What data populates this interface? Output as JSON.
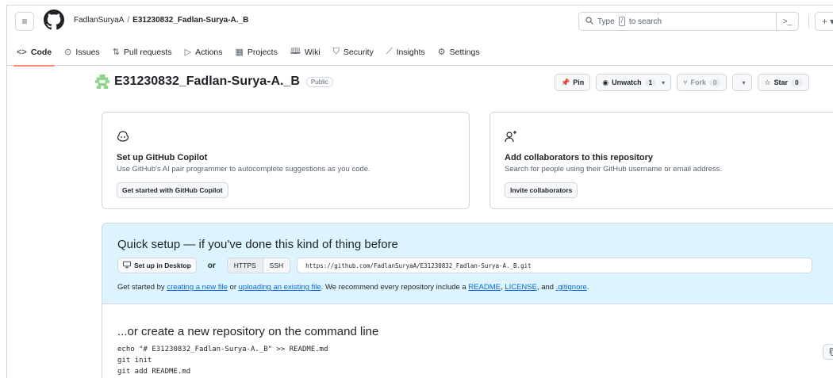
{
  "header": {
    "owner": "FadlanSuryaA",
    "separator": "/",
    "repo": "E31230832_Fadlan-Surya-A._B",
    "search_prefix": "Type",
    "search_key": "/",
    "search_suffix": "to search",
    "command_symbol": ">_",
    "plus_symbol": "+",
    "plus_caret": "▾"
  },
  "nav": {
    "tabs": [
      {
        "label": "Code",
        "icon": "code-icon",
        "glyph": "<>"
      },
      {
        "label": "Issues",
        "icon": "issue-icon",
        "glyph": "⊙"
      },
      {
        "label": "Pull requests",
        "icon": "pull-request-icon",
        "glyph": "⇅"
      },
      {
        "label": "Actions",
        "icon": "play-icon",
        "glyph": "▷"
      },
      {
        "label": "Projects",
        "icon": "table-icon",
        "glyph": "▦"
      },
      {
        "label": "Wiki",
        "icon": "book-icon",
        "glyph": "🕮"
      },
      {
        "label": "Security",
        "icon": "shield-icon",
        "glyph": "⛉"
      },
      {
        "label": "Insights",
        "icon": "graph-icon",
        "glyph": "⟋"
      },
      {
        "label": "Settings",
        "icon": "gear-icon",
        "glyph": "⚙"
      }
    ]
  },
  "repo": {
    "name": "E31230832_Fadlan-Surya-A._B",
    "visibility": "Public",
    "pin_label": "Pin",
    "unwatch_label": "Unwatch",
    "unwatch_count": "1",
    "fork_label": "Fork",
    "fork_count": "0",
    "star_label": "Star",
    "star_count": "0"
  },
  "cards": {
    "copilot": {
      "title": "Set up GitHub Copilot",
      "desc": "Use GitHub's AI pair programmer to autocomplete suggestions as you code.",
      "button": "Get started with GitHub Copilot"
    },
    "collab": {
      "title": "Add collaborators to this repository",
      "desc": "Search for people using their GitHub username or email address.",
      "button": "Invite collaborators"
    }
  },
  "quick_setup": {
    "title": "Quick setup — if you've done this kind of thing before",
    "desktop_button": "Set up in Desktop",
    "or": "or",
    "https": "HTTPS",
    "ssh": "SSH",
    "url": "https://github.com/FadlanSuryaA/E31230832_Fadlan-Surya-A._B.git",
    "help_1": "Get started by ",
    "help_link_1": "creating a new file",
    "help_2": " or ",
    "help_link_2": "uploading an existing file",
    "help_3": ". We recommend every repository include a ",
    "help_link_3": "README",
    "help_4": ", ",
    "help_link_4": "LICENSE",
    "help_5": ", and ",
    "help_link_5": ".gitignore",
    "help_6": "."
  },
  "command_line": {
    "title": "...or create a new repository on the command line",
    "code": "echo \"# E31230832_Fadlan-Surya-A._B\" >> README.md\ngit init\ngit add README.md\ngit commit -m \"first commit\""
  },
  "colors": {
    "accent_underline": "#fd8c73",
    "link": "#0969da",
    "quick_setup_bg": "#ddf4ff"
  }
}
